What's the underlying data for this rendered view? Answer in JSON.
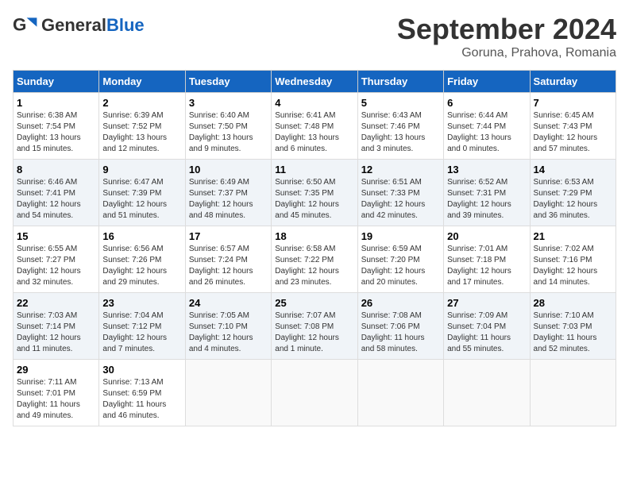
{
  "header": {
    "logo_general": "General",
    "logo_blue": "Blue",
    "month_year": "September 2024",
    "location": "Goruna, Prahova, Romania"
  },
  "days_of_week": [
    "Sunday",
    "Monday",
    "Tuesday",
    "Wednesday",
    "Thursday",
    "Friday",
    "Saturday"
  ],
  "weeks": [
    [
      {
        "day": "1",
        "info": "Sunrise: 6:38 AM\nSunset: 7:54 PM\nDaylight: 13 hours\nand 15 minutes."
      },
      {
        "day": "2",
        "info": "Sunrise: 6:39 AM\nSunset: 7:52 PM\nDaylight: 13 hours\nand 12 minutes."
      },
      {
        "day": "3",
        "info": "Sunrise: 6:40 AM\nSunset: 7:50 PM\nDaylight: 13 hours\nand 9 minutes."
      },
      {
        "day": "4",
        "info": "Sunrise: 6:41 AM\nSunset: 7:48 PM\nDaylight: 13 hours\nand 6 minutes."
      },
      {
        "day": "5",
        "info": "Sunrise: 6:43 AM\nSunset: 7:46 PM\nDaylight: 13 hours\nand 3 minutes."
      },
      {
        "day": "6",
        "info": "Sunrise: 6:44 AM\nSunset: 7:44 PM\nDaylight: 13 hours\nand 0 minutes."
      },
      {
        "day": "7",
        "info": "Sunrise: 6:45 AM\nSunset: 7:43 PM\nDaylight: 12 hours\nand 57 minutes."
      }
    ],
    [
      {
        "day": "8",
        "info": "Sunrise: 6:46 AM\nSunset: 7:41 PM\nDaylight: 12 hours\nand 54 minutes."
      },
      {
        "day": "9",
        "info": "Sunrise: 6:47 AM\nSunset: 7:39 PM\nDaylight: 12 hours\nand 51 minutes."
      },
      {
        "day": "10",
        "info": "Sunrise: 6:49 AM\nSunset: 7:37 PM\nDaylight: 12 hours\nand 48 minutes."
      },
      {
        "day": "11",
        "info": "Sunrise: 6:50 AM\nSunset: 7:35 PM\nDaylight: 12 hours\nand 45 minutes."
      },
      {
        "day": "12",
        "info": "Sunrise: 6:51 AM\nSunset: 7:33 PM\nDaylight: 12 hours\nand 42 minutes."
      },
      {
        "day": "13",
        "info": "Sunrise: 6:52 AM\nSunset: 7:31 PM\nDaylight: 12 hours\nand 39 minutes."
      },
      {
        "day": "14",
        "info": "Sunrise: 6:53 AM\nSunset: 7:29 PM\nDaylight: 12 hours\nand 36 minutes."
      }
    ],
    [
      {
        "day": "15",
        "info": "Sunrise: 6:55 AM\nSunset: 7:27 PM\nDaylight: 12 hours\nand 32 minutes."
      },
      {
        "day": "16",
        "info": "Sunrise: 6:56 AM\nSunset: 7:26 PM\nDaylight: 12 hours\nand 29 minutes."
      },
      {
        "day": "17",
        "info": "Sunrise: 6:57 AM\nSunset: 7:24 PM\nDaylight: 12 hours\nand 26 minutes."
      },
      {
        "day": "18",
        "info": "Sunrise: 6:58 AM\nSunset: 7:22 PM\nDaylight: 12 hours\nand 23 minutes."
      },
      {
        "day": "19",
        "info": "Sunrise: 6:59 AM\nSunset: 7:20 PM\nDaylight: 12 hours\nand 20 minutes."
      },
      {
        "day": "20",
        "info": "Sunrise: 7:01 AM\nSunset: 7:18 PM\nDaylight: 12 hours\nand 17 minutes."
      },
      {
        "day": "21",
        "info": "Sunrise: 7:02 AM\nSunset: 7:16 PM\nDaylight: 12 hours\nand 14 minutes."
      }
    ],
    [
      {
        "day": "22",
        "info": "Sunrise: 7:03 AM\nSunset: 7:14 PM\nDaylight: 12 hours\nand 11 minutes."
      },
      {
        "day": "23",
        "info": "Sunrise: 7:04 AM\nSunset: 7:12 PM\nDaylight: 12 hours\nand 7 minutes."
      },
      {
        "day": "24",
        "info": "Sunrise: 7:05 AM\nSunset: 7:10 PM\nDaylight: 12 hours\nand 4 minutes."
      },
      {
        "day": "25",
        "info": "Sunrise: 7:07 AM\nSunset: 7:08 PM\nDaylight: 12 hours\nand 1 minute."
      },
      {
        "day": "26",
        "info": "Sunrise: 7:08 AM\nSunset: 7:06 PM\nDaylight: 11 hours\nand 58 minutes."
      },
      {
        "day": "27",
        "info": "Sunrise: 7:09 AM\nSunset: 7:04 PM\nDaylight: 11 hours\nand 55 minutes."
      },
      {
        "day": "28",
        "info": "Sunrise: 7:10 AM\nSunset: 7:03 PM\nDaylight: 11 hours\nand 52 minutes."
      }
    ],
    [
      {
        "day": "29",
        "info": "Sunrise: 7:11 AM\nSunset: 7:01 PM\nDaylight: 11 hours\nand 49 minutes."
      },
      {
        "day": "30",
        "info": "Sunrise: 7:13 AM\nSunset: 6:59 PM\nDaylight: 11 hours\nand 46 minutes."
      },
      {
        "day": "",
        "info": ""
      },
      {
        "day": "",
        "info": ""
      },
      {
        "day": "",
        "info": ""
      },
      {
        "day": "",
        "info": ""
      },
      {
        "day": "",
        "info": ""
      }
    ]
  ]
}
